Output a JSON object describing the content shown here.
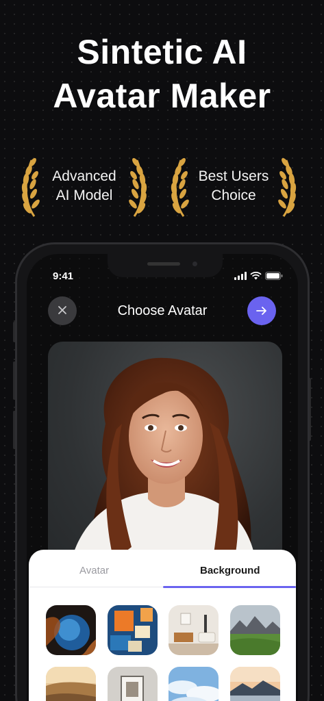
{
  "headline": {
    "line1": "Sintetic AI",
    "line2": "Avatar Maker"
  },
  "awards": [
    {
      "line1": "Advanced",
      "line2": "AI Model"
    },
    {
      "line1": "Best Users",
      "line2": "Choice"
    }
  ],
  "status_bar": {
    "time": "9:41"
  },
  "nav": {
    "title": "Choose Avatar",
    "close_icon": "close-icon",
    "next_icon": "arrow-right-icon"
  },
  "tabs": [
    {
      "label": "Avatar",
      "active": false
    },
    {
      "label": "Background",
      "active": true
    }
  ],
  "colors": {
    "accent": "#6a63ef",
    "laurel": "#d9a441",
    "background": "#0d0d0f"
  },
  "backgrounds": [
    {
      "name": "blue-nebula"
    },
    {
      "name": "orange-abstract-paint"
    },
    {
      "name": "living-room"
    },
    {
      "name": "mountain-meadow"
    },
    {
      "name": "desert-sunset"
    },
    {
      "name": "interior-frame"
    },
    {
      "name": "cloudy-sky"
    },
    {
      "name": "lake-mountain"
    }
  ]
}
